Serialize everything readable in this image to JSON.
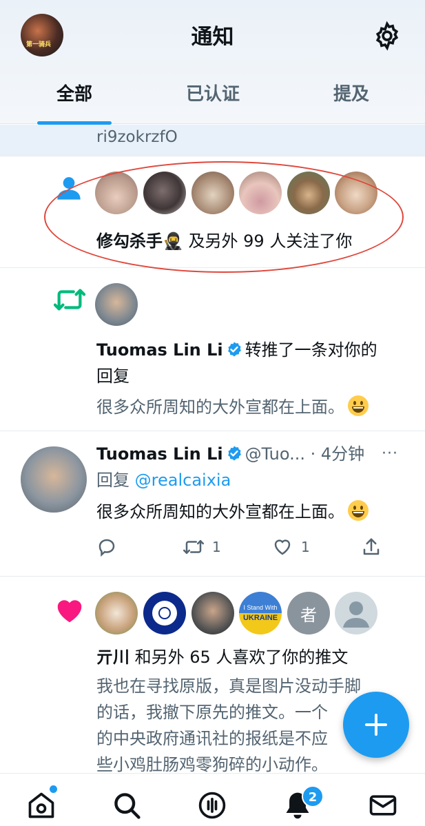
{
  "header": {
    "title": "通知",
    "avatar_badge": "第一骑兵"
  },
  "tabs": [
    {
      "label": "全部"
    },
    {
      "label": "已认证"
    },
    {
      "label": "提及"
    }
  ],
  "partial_row": {
    "text": "ri9zokrzfO"
  },
  "follow_notif": {
    "name": "修勾杀手🥷",
    "rest": " 及另外 99 人关注了你"
  },
  "retweet_notif": {
    "name": "Tuomas Lin Li",
    "action": "转推了一条对你的",
    "action2": "回复",
    "preview": "很多众所周知的大外宣都在上面。"
  },
  "tweet": {
    "name": "Tuomas Lin Li",
    "handle": "@Tuo...",
    "time": "· 4分钟",
    "reply_prefix": "回复 ",
    "reply_to": "@realcaixia",
    "body": "很多众所周知的大外宣都在上面。",
    "retweets": "1",
    "likes": "1",
    "more": "···"
  },
  "like_notif": {
    "name": "亓川",
    "rest": " 和另外 65 人喜欢了你的推文",
    "preview_lines": [
      "我也在寻找原版，真是图片没动手脚",
      "的话，我撤下原先的推文。一个",
      "的中央政府通讯社的报纸是不应",
      "些小鸡肚肠鸡零狗碎的小动作。"
    ],
    "avatar_text_1": "I Stand With",
    "avatar_text_2": "UKRAINE",
    "avatar_char": "者"
  },
  "bottom_nav": {
    "notifications_badge": "2"
  },
  "colors": {
    "accent": "#1d9bf0",
    "retweet_green": "#00ba7c",
    "like_pink": "#f91880",
    "annotation_red": "#e0473c"
  }
}
